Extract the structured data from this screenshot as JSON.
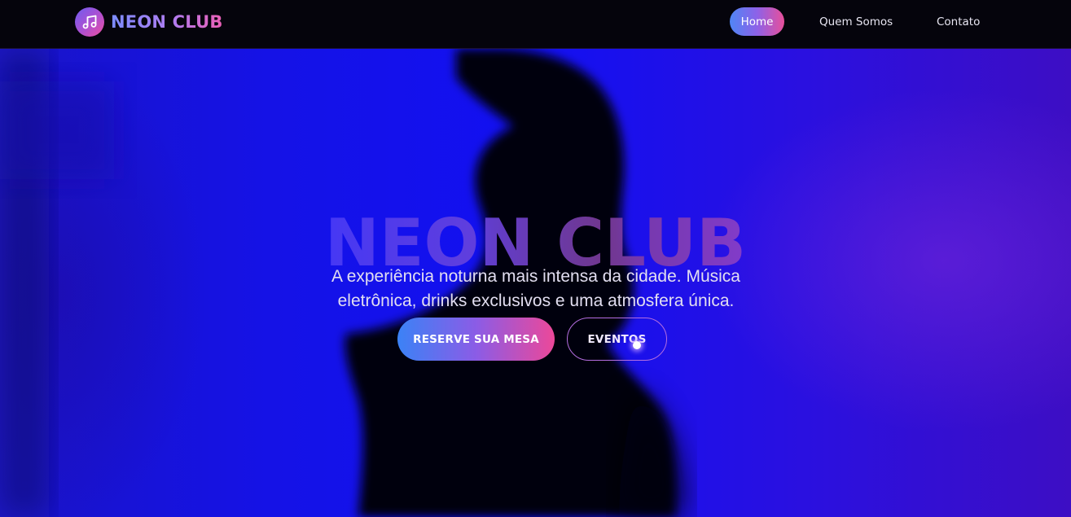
{
  "brand": {
    "name": "NEON CLUB",
    "icon": "music-note-icon"
  },
  "nav": {
    "items": [
      {
        "label": "Home",
        "active": true
      },
      {
        "label": "Quem Somos",
        "active": false
      },
      {
        "label": "Contato",
        "active": false
      }
    ]
  },
  "hero": {
    "title": "NEON CLUB",
    "subtitle": "A experiência noturna mais intensa da cidade. Música eletrônica, drinks exclusivos e uma atmosfera única.",
    "primary_button": "RESERVE SUA MESA",
    "secondary_button": "EVENTOS"
  },
  "colors": {
    "navbar_bg": "#05040c",
    "hero_blue": "#1512e6",
    "gradient_start": "#3b82f6",
    "gradient_mid": "#8b5ce6",
    "gradient_end": "#ec4899"
  }
}
